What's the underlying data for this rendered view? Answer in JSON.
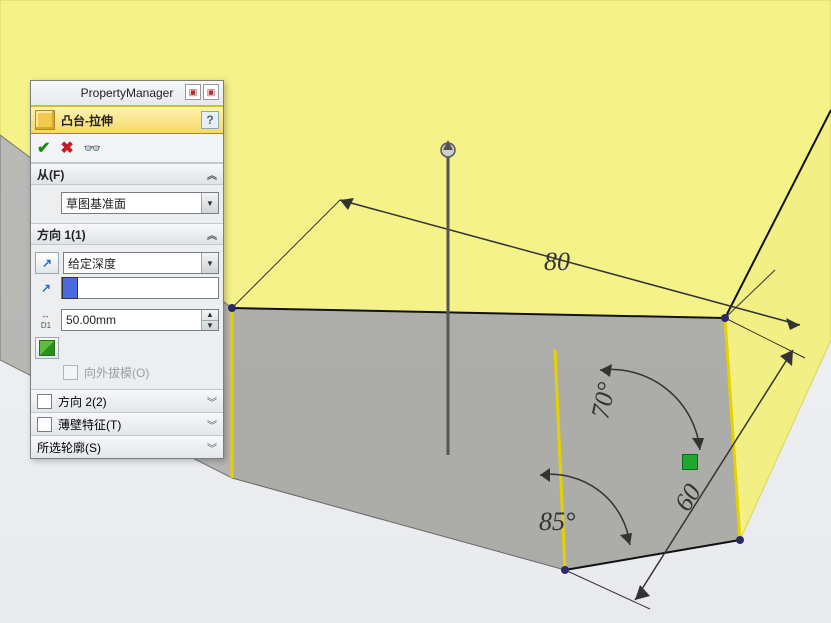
{
  "panel": {
    "title": "PropertyManager",
    "feature_name": "凸台-拉伸",
    "help": "?",
    "sections": {
      "from": {
        "label": "从(F)",
        "value": "草图基准面"
      },
      "dir1": {
        "label": "方向 1(1)",
        "end_condition": "给定深度",
        "depth": "50.00mm",
        "draft_label": "向外拔模(O)"
      },
      "dir2": {
        "label": "方向 2(2)"
      },
      "thin": {
        "label": "薄壁特征(T)"
      },
      "contours": {
        "label": "所选轮廓(S)"
      }
    }
  },
  "dimensions": {
    "d80": "80",
    "d60": "60",
    "a70": "70°",
    "a85": "85°"
  }
}
